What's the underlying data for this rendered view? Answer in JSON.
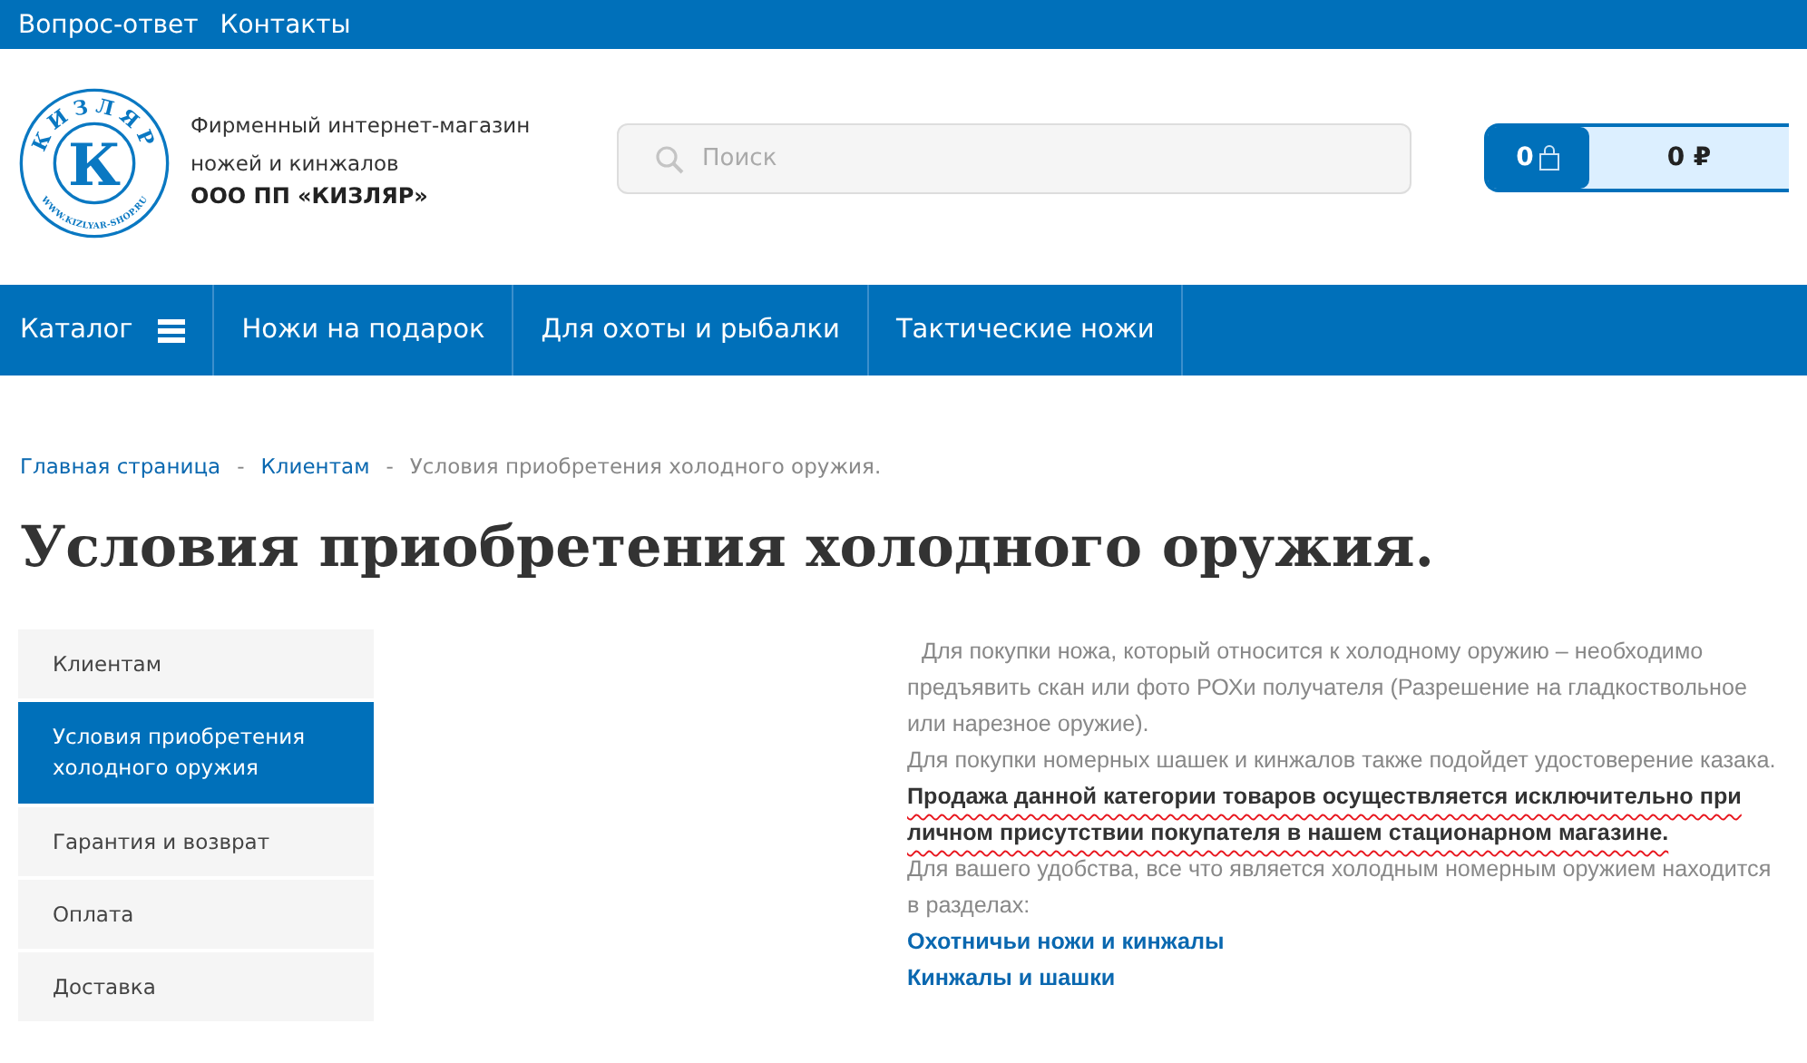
{
  "top_links": [
    "Вопрос-ответ",
    "Контакты"
  ],
  "logo": {
    "arc_text": "КИЗЛЯР",
    "letter": "К",
    "url_text": "WWW.KIZLYAR-SHOP.RU"
  },
  "tagline": [
    "Фирменный интернет-магазин",
    "ножей и кинжалов"
  ],
  "company": "ООО ПП «КИЗЛЯР»",
  "search": {
    "placeholder": "Поиск"
  },
  "cart": {
    "count": "0",
    "total": "0 ₽"
  },
  "nav": [
    {
      "label": "Каталог",
      "kind": "menu"
    },
    {
      "label": "Ножи на подарок",
      "kind": "link"
    },
    {
      "label": "Для охоты и рыбалки",
      "kind": "link"
    },
    {
      "label": "Тактические ножи",
      "kind": "link"
    }
  ],
  "breadcrumb": [
    {
      "label": "Главная страница",
      "kind": "link"
    },
    {
      "label": "-",
      "kind": "separator"
    },
    {
      "label": "Клиентам",
      "kind": "link"
    },
    {
      "label": "-",
      "kind": "separator"
    },
    {
      "label": "Условия приобретения холодного оружия.",
      "kind": "current"
    }
  ],
  "title": "Условия приобретения холодного оружия.",
  "sidebar": {
    "items": [
      {
        "label": "Клиентам",
        "selected": false
      },
      {
        "label": "Условия приобретения холодного оружия",
        "selected": true
      },
      {
        "label": "Гарантия и возврат",
        "selected": false
      },
      {
        "label": "Оплата",
        "selected": false
      },
      {
        "label": "Доставка",
        "selected": false
      }
    ]
  },
  "content": [
    {
      "kind": "text",
      "text": "Для покупки ножа, который относится к холодному оружию – необходимо предъявить скан или фото РОХи получателя (Разрешение на гладкоствольное или нарезное оружие)."
    },
    {
      "kind": "text",
      "text": "Для покупки номерных шашек и кинжалов также подойдет удостоверение казака."
    },
    {
      "kind": "bold",
      "text": "Продажа данной категории товаров осуществляется исключительно при личном присутствии покупателя в нашем стационарном магазине."
    },
    {
      "kind": "text",
      "text": "Для вашего удобства, все что является холодным номерным оружием находится в разделах:"
    },
    {
      "kind": "link",
      "text": "Охотничьи ножи и кинжалы"
    },
    {
      "kind": "link",
      "text": "Кинжалы и шашки"
    }
  ]
}
